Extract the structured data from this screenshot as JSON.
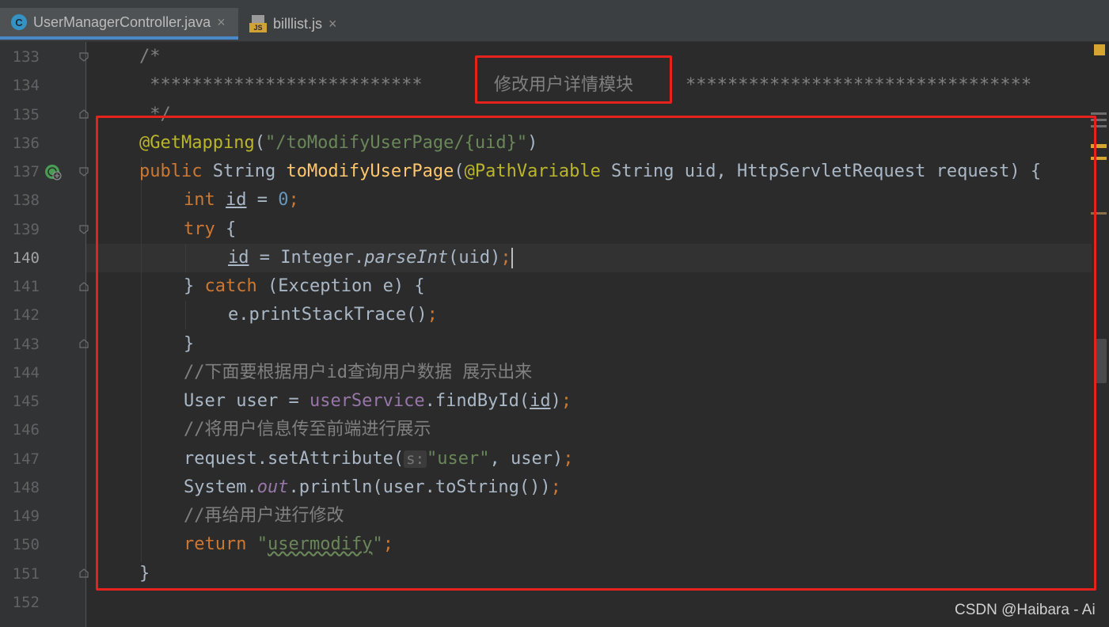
{
  "tabs": [
    {
      "label": "UserManagerController.java",
      "icon": "C",
      "active": true
    },
    {
      "label": "billlist.js",
      "icon": "JS",
      "active": false
    }
  ],
  "close_glyph": "×",
  "line_numbers": [
    "133",
    "134",
    "135",
    "136",
    "137",
    "138",
    "139",
    "140",
    "141",
    "142",
    "143",
    "144",
    "145",
    "146",
    "147",
    "148",
    "149",
    "150",
    "151",
    "152"
  ],
  "current_line": "140",
  "code": {
    "l133": "/*",
    "l134_stars_left": " **************************",
    "l134_title": "修改用户详情模块",
    "l134_stars_right": "*********************************",
    "l135": " */",
    "l136_annotation": "@GetMapping",
    "l136_paren_open": "(",
    "l136_path": "\"/toModifyUserPage/{uid}\"",
    "l136_paren_close": ")",
    "l137_public": "public",
    "l137_type": " String ",
    "l137_method": "toModifyUserPage",
    "l137_open": "(",
    "l137_anno": "@PathVariable",
    "l137_params": " String uid, HttpServletRequest request) {",
    "l138_int": "int",
    "l138_var": "id",
    "l138_eq": " = ",
    "l138_zero": "0",
    "l138_semi": ";",
    "l139_try": "try",
    "l139_brace": " {",
    "l140_var": "id",
    "l140_assign": " = Integer.",
    "l140_parse": "parseInt",
    "l140_args": "(uid)",
    "l140_semi": ";",
    "l141_close": "} ",
    "l141_catch": "catch",
    "l141_rest": " (Exception e) {",
    "l142_call": "e.printStackTrace()",
    "l142_semi": ";",
    "l143": "}",
    "l144": "//下面要根据用户id查询用户数据 展示出来",
    "l145_decl": "User user = ",
    "l145_field": "userService",
    "l145_call": ".findById(",
    "l145_arg": "id",
    "l145_close": ")",
    "l145_semi": ";",
    "l146": "//将用户信息传至前端进行展示",
    "l147_call": "request.setAttribute(",
    "l147_hint": "s:",
    "l147_str": "\"user\"",
    "l147_rest": ", user)",
    "l147_semi": ";",
    "l148_sys": "System.",
    "l148_out": "out",
    "l148_rest": ".println(user.toString())",
    "l148_semi": ";",
    "l149": "//再给用户进行修改",
    "l150_return": "return",
    "l150_space": " ",
    "l150_q1": "\"",
    "l150_str": "usermodify",
    "l150_q2": "\"",
    "l150_semi": ";",
    "l151": "}"
  },
  "watermark": "CSDN @Haibara - Ai",
  "colors": {
    "keyword": "#cc7832",
    "string": "#6a8759",
    "annotation": "#bbb529",
    "method": "#ffc66d",
    "comment": "#808080",
    "highlight": "#e5221c"
  }
}
